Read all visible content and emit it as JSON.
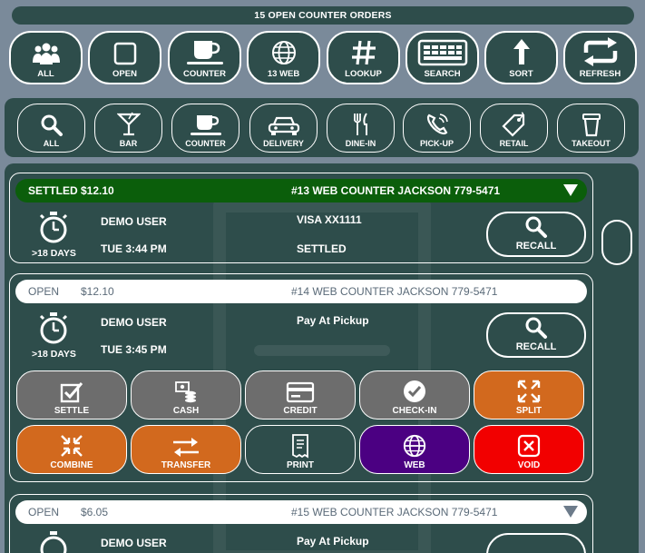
{
  "header": {
    "title": "15 OPEN COUNTER ORDERS"
  },
  "top_buttons": [
    {
      "label": "ALL",
      "icon": "people-icon"
    },
    {
      "label": "OPEN",
      "icon": "square-icon"
    },
    {
      "label": "COUNTER",
      "icon": "coffee-cup-icon"
    },
    {
      "label": "13 WEB",
      "icon": "globe-icon"
    },
    {
      "label": "LOOKUP",
      "icon": "hash-icon"
    },
    {
      "label": "SEARCH",
      "icon": "keyboard-icon"
    },
    {
      "label": "SORT",
      "icon": "arrow-up-icon"
    },
    {
      "label": "REFRESH",
      "icon": "refresh-icon"
    }
  ],
  "filter_buttons": [
    {
      "label": "ALL",
      "icon": "magnifier-icon"
    },
    {
      "label": "BAR",
      "icon": "martini-icon"
    },
    {
      "label": "COUNTER",
      "icon": "coffee-cup-icon"
    },
    {
      "label": "DELIVERY",
      "icon": "car-icon"
    },
    {
      "label": "DINE-IN",
      "icon": "fork-knife-icon"
    },
    {
      "label": "PICK-UP",
      "icon": "phone-icon"
    },
    {
      "label": "RETAIL",
      "icon": "tag-icon"
    },
    {
      "label": "TAKEOUT",
      "icon": "takeout-cup-icon"
    }
  ],
  "orders": [
    {
      "status": "SETTLED",
      "amount": "$12.10",
      "title": "#13  WEB COUNTER JACKSON 779-5471",
      "days": ">18 DAYS",
      "user": "DEMO USER",
      "time": "TUE 3:44 PM",
      "payment": "VISA XX1111",
      "payment_status": "SETTLED",
      "recall_label": "RECALL"
    },
    {
      "status": "OPEN",
      "amount": "$12.10",
      "title": "#14  WEB COUNTER JACKSON 779-5471",
      "days": ">18 DAYS",
      "user": "DEMO USER",
      "time": "TUE 3:45 PM",
      "payment": "Pay At Pickup",
      "recall_label": "RECALL",
      "actions": [
        {
          "label": "SETTLE",
          "icon": "checkbox-icon",
          "color": "#6d6d6d"
        },
        {
          "label": "CASH",
          "icon": "cash-icon",
          "color": "#6d6d6d"
        },
        {
          "label": "CREDIT",
          "icon": "credit-card-icon",
          "color": "#6d6d6d"
        },
        {
          "label": "CHECK-IN",
          "icon": "check-circle-icon",
          "color": "#6d6d6d"
        },
        {
          "label": "SPLIT",
          "icon": "split-arrows-icon",
          "color": "#d2691e"
        },
        {
          "label": "COMBINE",
          "icon": "combine-arrows-icon",
          "color": "#d2691e"
        },
        {
          "label": "TRANSFER",
          "icon": "transfer-arrows-icon",
          "color": "#d2691e"
        },
        {
          "label": "PRINT",
          "icon": "receipt-icon",
          "color": "#2e4d4b"
        },
        {
          "label": "WEB",
          "icon": "globe-icon",
          "color": "#4b0082"
        },
        {
          "label": "VOID",
          "icon": "void-x-icon",
          "color": "#f20000"
        }
      ]
    },
    {
      "status": "OPEN",
      "amount": "$6.05",
      "title": "#15  WEB COUNTER JACKSON 779-5471",
      "user": "DEMO USER",
      "payment": "Pay At Pickup"
    }
  ]
}
